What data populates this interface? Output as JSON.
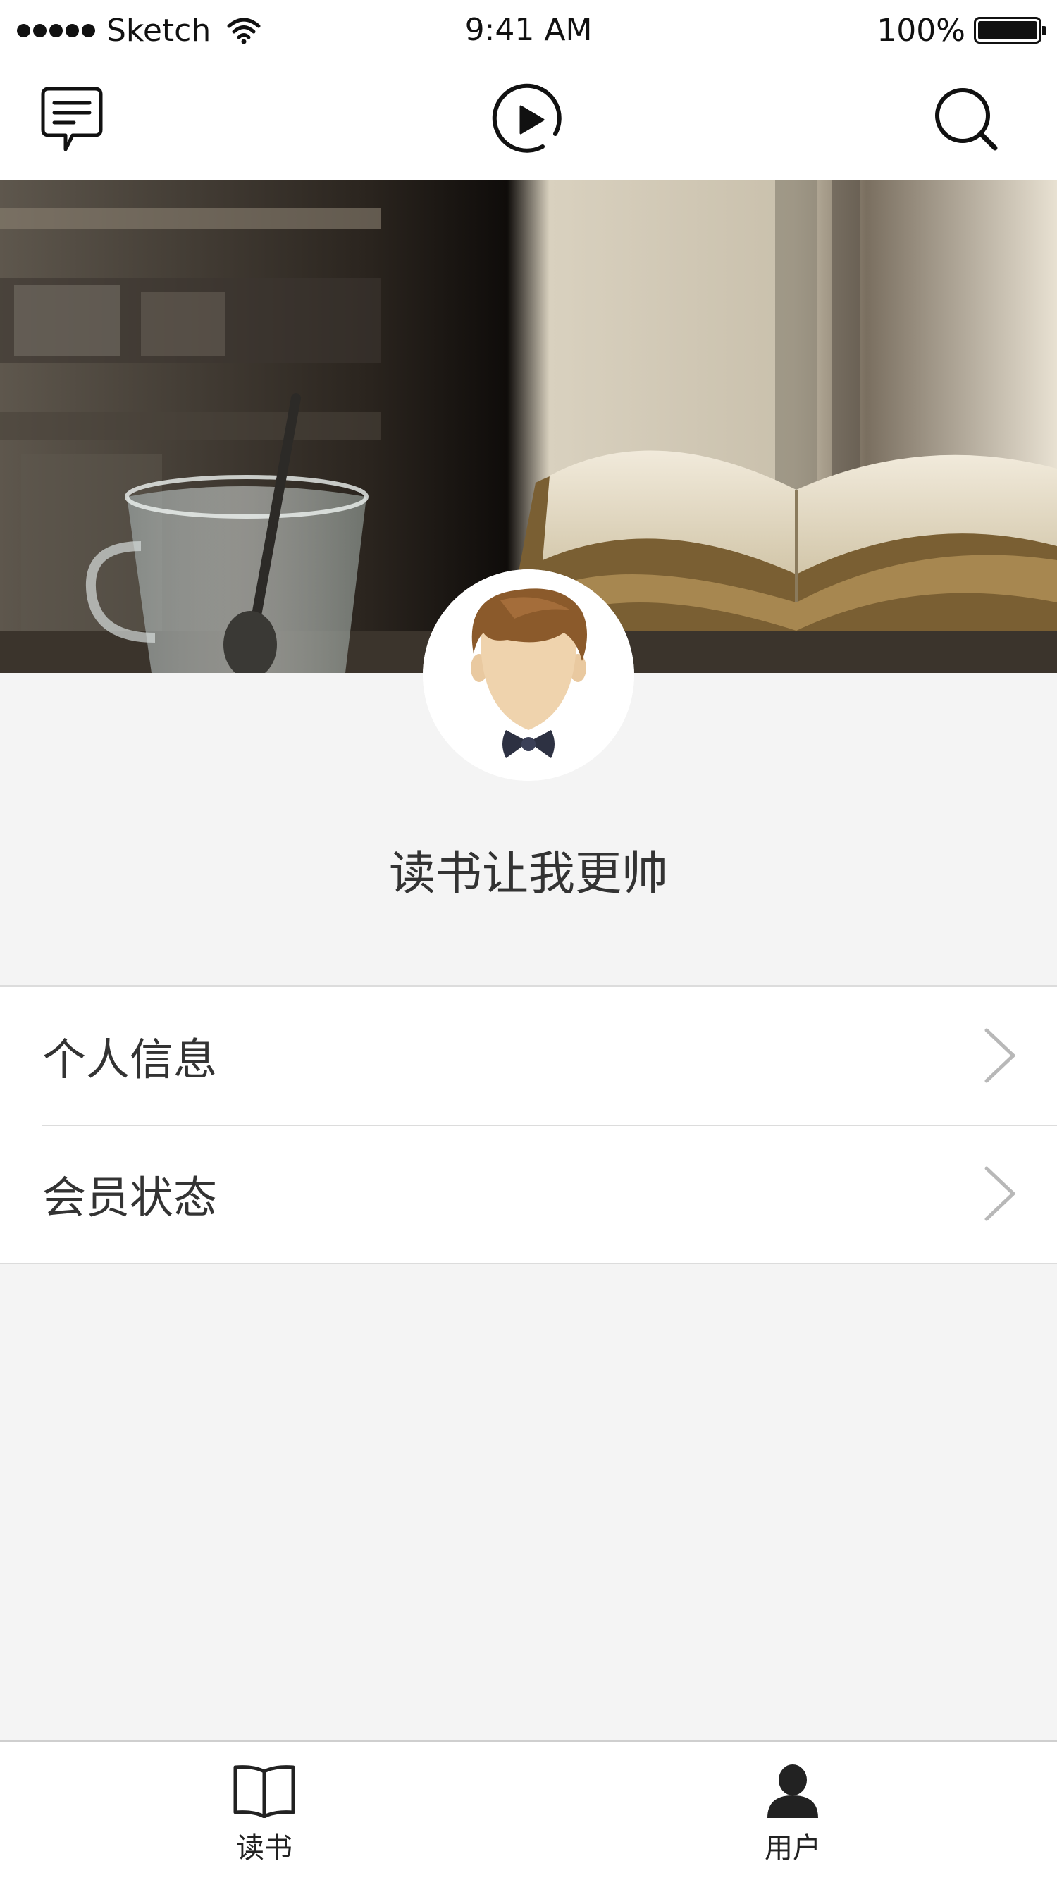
{
  "status_bar": {
    "carrier": "Sketch",
    "time": "9:41 AM",
    "battery": "100%"
  },
  "nav": {
    "left_icon": "message-icon",
    "center_icon": "play-circle-icon",
    "right_icon": "search-icon"
  },
  "profile": {
    "name": "读书让我更帅",
    "avatar": "avatar-man-bowtie"
  },
  "menu": {
    "items": [
      {
        "label": "个人信息",
        "icon": "chevron-right-icon"
      },
      {
        "label": "会员状态",
        "icon": "chevron-right-icon"
      }
    ]
  },
  "tab_bar": {
    "tabs": [
      {
        "label": "读书",
        "icon": "book-icon"
      },
      {
        "label": "用户",
        "icon": "user-icon"
      }
    ]
  },
  "colors": {
    "background": "#f4f4f4",
    "surface": "#ffffff",
    "text": "#333333",
    "divider": "#dcdcdc",
    "chevron": "#b8b8b8"
  }
}
